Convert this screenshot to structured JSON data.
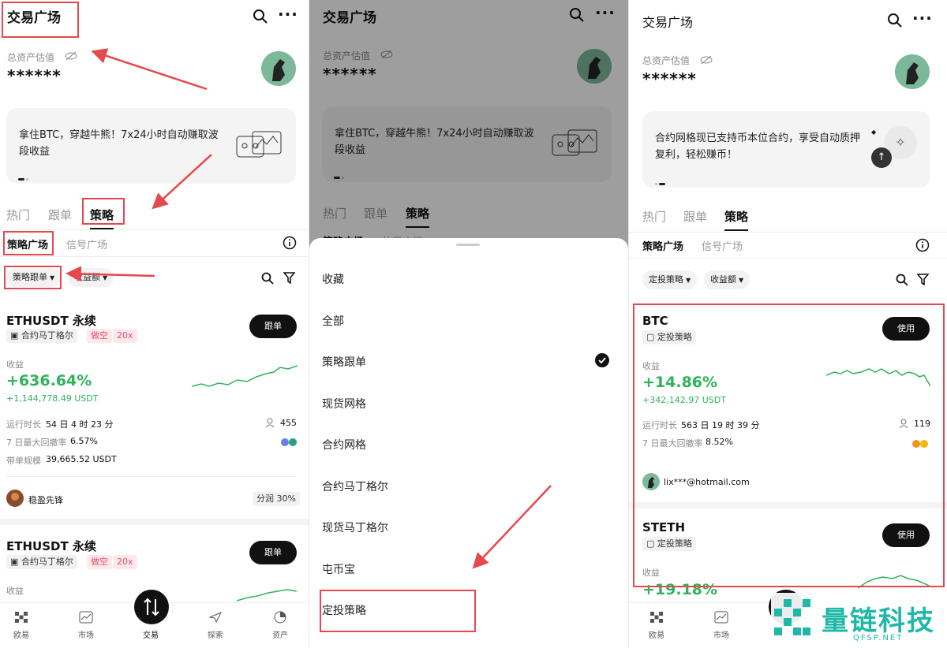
{
  "colors": {
    "accent_green": "#2fb35a",
    "annotation_red": "#e5484d",
    "tag_pink": "#e0506a"
  },
  "screen1": {
    "title": "交易广场",
    "asset_label": "总资产估值",
    "asset_value": "******",
    "banner_text": "拿住BTC，穿越牛熊！7x24小时自动赚取波段收益",
    "tabs": [
      "热门",
      "跟单",
      "策略"
    ],
    "subtabs": [
      "策略广场",
      "信号广场"
    ],
    "filters": [
      "策略跟单",
      "收益额"
    ],
    "card1": {
      "coin": "ETHUSDT 永续",
      "tags": [
        "合约马丁格尔",
        "做空",
        "20x"
      ],
      "button": "跟单",
      "profit_label": "收益",
      "profit_pct": "+636.64%",
      "profit_usdt": "+1,144,778.49 USDT",
      "runtime_label": "运行时长",
      "runtime_value": "54 日 4 时 23 分",
      "followers": "455",
      "drawdown_label": "7 日最大回撤率",
      "drawdown_value": "6.57%",
      "scale_label": "带单规模",
      "scale_value": "39,665.52 USDT",
      "leader": "稳盈先锋",
      "share": "分润 30%"
    },
    "card2": {
      "coin": "ETHUSDT 永续",
      "tags": [
        "合约马丁格尔",
        "做空",
        "20x"
      ],
      "button": "跟单",
      "profit_label": "收益"
    },
    "nav": [
      "欧易",
      "市场",
      "交易",
      "探索",
      "资产"
    ]
  },
  "screen2": {
    "title": "交易广场",
    "asset_label": "总资产估值",
    "asset_value": "******",
    "banner_text": "拿住BTC，穿越牛熊！7x24小时自动赚取波段收益",
    "tabs": [
      "热门",
      "跟单",
      "策略"
    ],
    "subtabs_partial": [
      "策略广场",
      "信号广场"
    ],
    "menu": [
      "收藏",
      "全部",
      "策略跟单",
      "现货网格",
      "合约网格",
      "合约马丁格尔",
      "现货马丁格尔",
      "屯币宝",
      "定投策略"
    ],
    "selected": "策略跟单"
  },
  "screen3": {
    "title": "交易广场",
    "asset_label": "总资产估值",
    "asset_value": "******",
    "banner_text": "合约网格现已支持币本位合约，享受自动质押复利，轻松赚币！",
    "tabs": [
      "热门",
      "跟单",
      "策略"
    ],
    "subtabs": [
      "策略广场",
      "信号广场"
    ],
    "filters": [
      "定投策略",
      "收益额"
    ],
    "card1": {
      "coin": "BTC",
      "tag": "定投策略",
      "button": "使用",
      "profit_label": "收益",
      "profit_pct": "+14.86%",
      "profit_usdt": "+342,142.97 USDT",
      "runtime_label": "运行时长",
      "runtime_value": "563 日 19 时 39 分",
      "followers": "119",
      "drawdown_label": "7 日最大回撤率",
      "drawdown_value": "8.52%",
      "creator": "lix***@hotmail.com"
    },
    "card2": {
      "coin": "STETH",
      "tag": "定投策略",
      "button": "使用",
      "profit_label": "收益",
      "profit_pct": "+19.18%"
    },
    "nav": [
      "欧易",
      "市场"
    ]
  },
  "watermark": {
    "brand": "量链科技",
    "domain": "QFSP.NET"
  }
}
